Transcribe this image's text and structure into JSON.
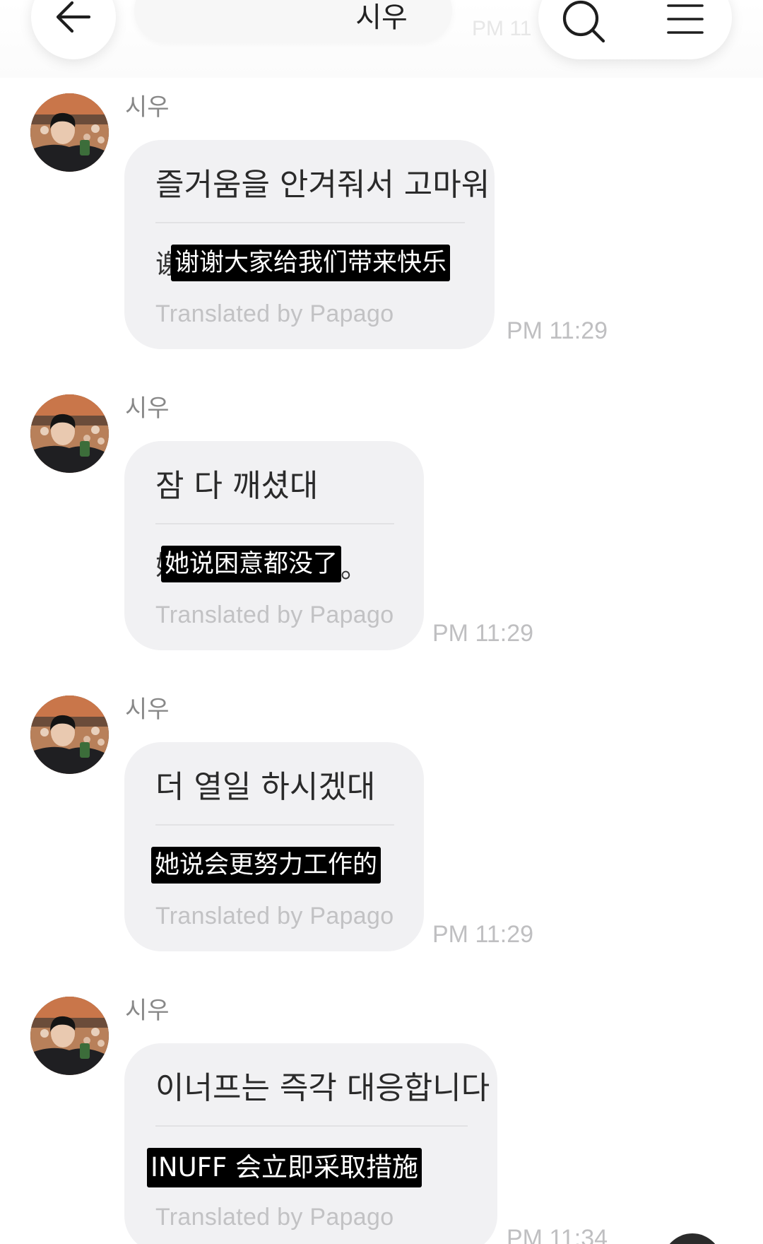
{
  "header": {
    "title": "시우",
    "ghost_time": "PM 11"
  },
  "messages": [
    {
      "sender": "시우",
      "original": "즐거움을 안겨줘서 고마워",
      "translation_under": "谢",
      "translation": "谢谢大家给我们带来快乐",
      "credit": "Translated by Papago",
      "time": "PM 11:29"
    },
    {
      "sender": "시우",
      "original": "잠 다 깨셨대",
      "translation_under": "她",
      "translation": "她说困意都没了",
      "translation_tail": "。",
      "credit": "Translated by Papago",
      "time": "PM 11:29"
    },
    {
      "sender": "시우",
      "original": "더 열일 하시겠대",
      "translation_under": "",
      "translation": "她说会更努力工作的",
      "credit": "Translated by Papago",
      "time": "PM 11:29"
    },
    {
      "sender": "시우",
      "original": "이너프는 즉각 대응합니다",
      "translation_under": "",
      "translation": "INUFF 会立即采取措施",
      "credit": "Translated by Papago",
      "time": "PM 11:34"
    }
  ],
  "icons": {
    "back": "arrow-left-icon",
    "search": "search-icon",
    "menu": "hamburger-menu-icon"
  },
  "colors": {
    "bubble": "#f1f1f3",
    "overlay": "#000000",
    "muted_text": "#bfbfc1"
  }
}
